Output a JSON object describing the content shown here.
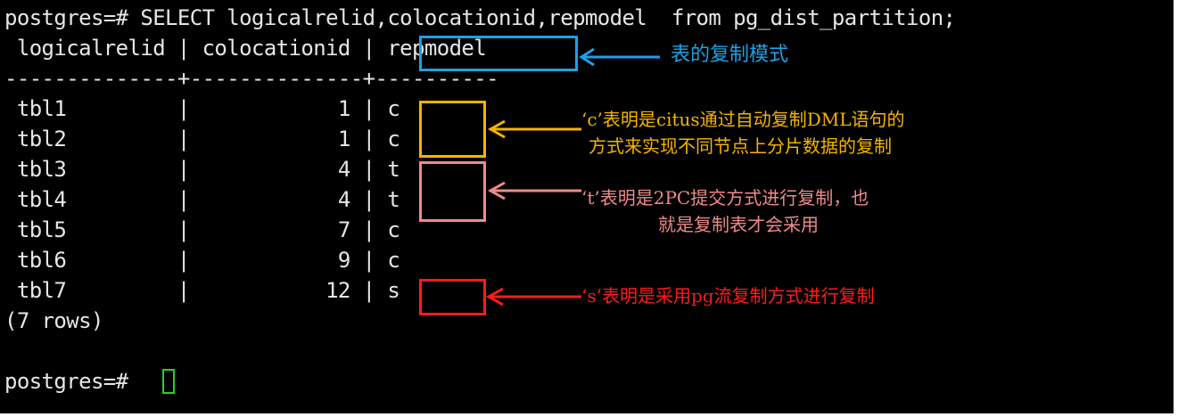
{
  "terminal": {
    "lines": [
      "postgres=# SELECT logicalrelid,colocationid,repmodel  from pg_dist_partition;",
      " logicalrelid | colocationid | repmodel",
      "--------------+--------------+----------",
      " tbl1         |            1 | c",
      " tbl2         |            1 | c",
      " tbl3         |            4 | t",
      " tbl4         |            4 | t",
      " tbl5         |            7 | c",
      " tbl6         |            9 | c",
      " tbl7         |           12 | s",
      "(7 rows)",
      "",
      "postgres=# "
    ]
  },
  "annotations": {
    "header_note": "表的复制模式",
    "c_note_line1": "‘c’表明是citus通过自动复制DML语句的",
    "c_note_line2": "方式来实现不同节点上分片数据的复制",
    "t_note_line1": "‘t’表明是2PC提交方式进行复制，也",
    "t_note_line2": "就是复制表才会采用",
    "s_note": "‘s’表明是采用pg流复制方式进行复制"
  },
  "colors": {
    "terminal_bg": "#000000",
    "terminal_text": "#e6e6e6",
    "cursor": "#26d026",
    "header_box": "#1ea0e6",
    "c_box": "#f5b400",
    "t_box": "#f08a8a",
    "s_box": "#ff1a1a"
  }
}
